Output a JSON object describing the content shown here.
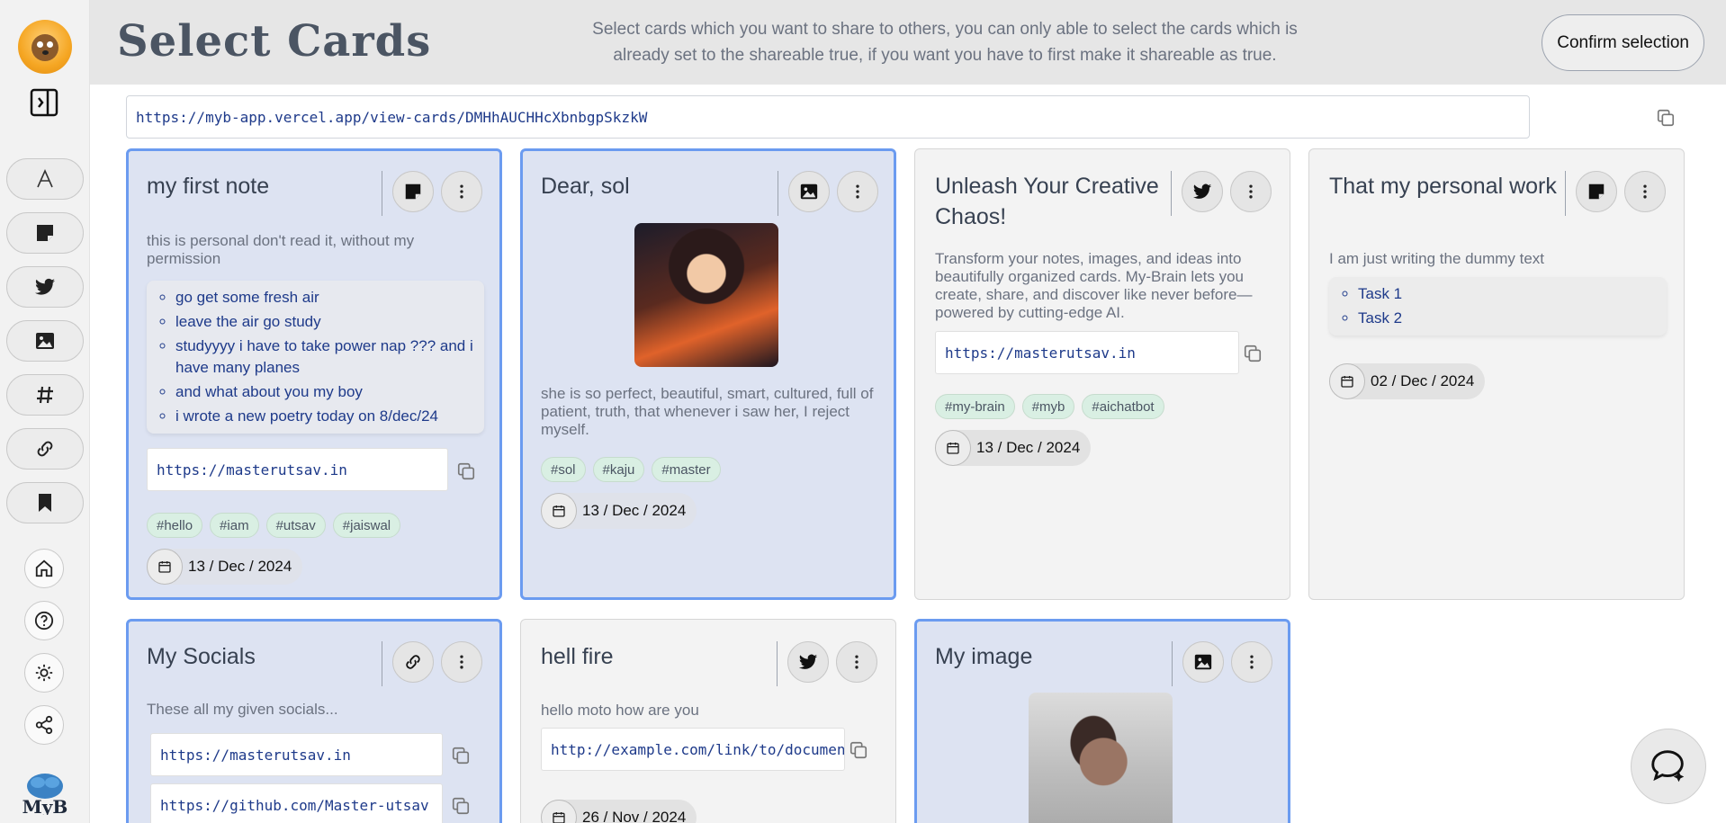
{
  "header": {
    "title": "Select Cards",
    "description": "Select cards which you want to share to others, you can only able to select the cards which is already set to the shareable true, if you want you have to first make it shareable as true.",
    "confirm_label": "Confirm selection"
  },
  "share": {
    "link": "https://myb-app.vercel.app/view-cards/DMHhAUCHHcXbnbgpSkzkW"
  },
  "sidebar": {
    "brand": "MyB",
    "filters": [
      "font-icon",
      "note-icon",
      "twitter-icon",
      "image-icon",
      "hashtag-icon",
      "link-icon",
      "bookmark-icon"
    ],
    "nav": [
      "home-icon",
      "help-icon",
      "sun-icon",
      "share-icon"
    ]
  },
  "cards": [
    {
      "title": "my first note",
      "type": "note",
      "selected": true,
      "description": "this is personal don't read it, without my permission",
      "list": [
        "go get some fresh air",
        "leave the air go study",
        "studyyyy i have to take power nap ??? and i have many planes",
        "and what about you my boy",
        "i wrote a new poetry today on 8/dec/24"
      ],
      "link": "https://masterutsav.in",
      "tags": [
        "#hello",
        "#iam",
        "#utsav",
        "#jaiswal"
      ],
      "date": "13 / Dec / 2024"
    },
    {
      "title": "Dear, sol",
      "type": "image",
      "selected": true,
      "description": "she is so perfect, beautiful, smart, cultured, full of patient, truth, that whenever i saw her, I reject myself.",
      "tags": [
        "#sol",
        "#kaju",
        "#master"
      ],
      "date": "13 / Dec / 2024"
    },
    {
      "title": "Unleash Your Creative Chaos!",
      "type": "twitter",
      "selected": false,
      "description": "Transform your notes, images, and ideas into beautifully organized cards. My-Brain lets you create, share, and discover like never before—powered by cutting-edge AI.",
      "link": "https://masterutsav.in",
      "tags": [
        "#my-brain",
        "#myb",
        "#aichatbot"
      ],
      "date": "13 / Dec / 2024"
    },
    {
      "title": "That my personal work",
      "type": "note",
      "selected": false,
      "description": "I am just writing the dummy text",
      "list": [
        "Task 1",
        "Task 2"
      ],
      "date": "02 / Dec / 2024"
    },
    {
      "title": "My Socials",
      "type": "link",
      "selected": true,
      "description": "These all my given socials...",
      "links": [
        "https://masterutsav.in",
        "https://github.com/Master-utsav"
      ]
    },
    {
      "title": "hell fire",
      "type": "twitter",
      "selected": false,
      "description": "hello moto how are you",
      "link": "http://example.com/link/to/document",
      "date": "26 / Nov / 2024"
    },
    {
      "title": "My image",
      "type": "image",
      "selected": true
    }
  ],
  "colors": {
    "selected_border": "#6b9bf0",
    "selected_bg": "#dde3f2",
    "link_text": "#1e3a8a",
    "tag_bg": "#d9efe3"
  }
}
